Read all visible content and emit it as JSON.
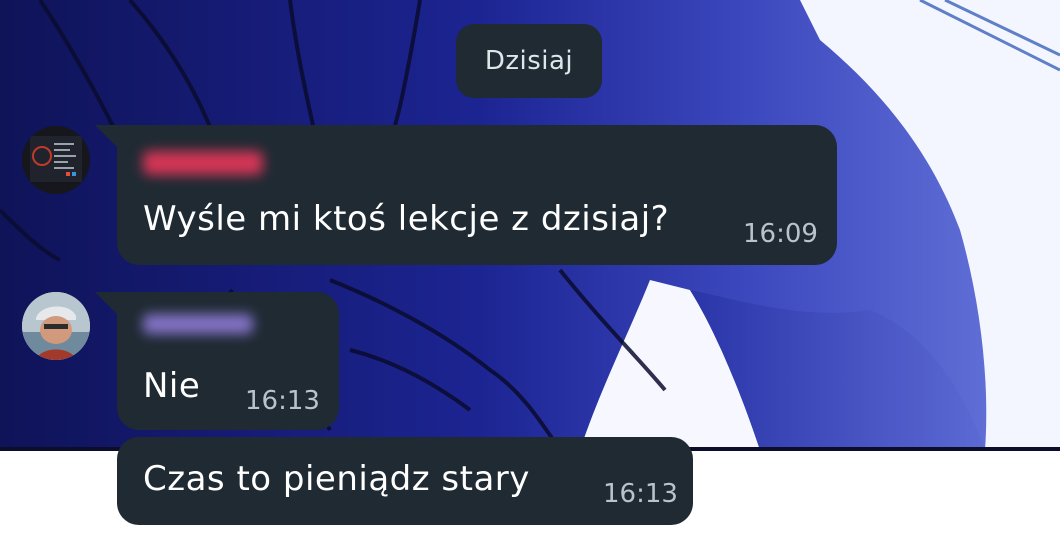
{
  "date_chip": {
    "label": "Dzisiaj"
  },
  "messages": [
    {
      "sender_redacted": true,
      "avatar": "code-screenshot-avatar",
      "text": "Wyśle mi ktoś lekcje z dzisiaj?",
      "time": "16:09"
    },
    {
      "sender_redacted": true,
      "avatar": "person-avatar",
      "text": "Nie",
      "time": "16:13"
    },
    {
      "text": "Czas to pieniądz stary",
      "time": "16:13"
    }
  ],
  "colors": {
    "bubble": "#1f2a33",
    "time_text": "#b9c4ca",
    "wallpaper_dark": "#0f1560",
    "wallpaper_blue": "#3743b6",
    "sender_1_blur": "#e8375a",
    "sender_2_blur": "#8f7bd8"
  }
}
